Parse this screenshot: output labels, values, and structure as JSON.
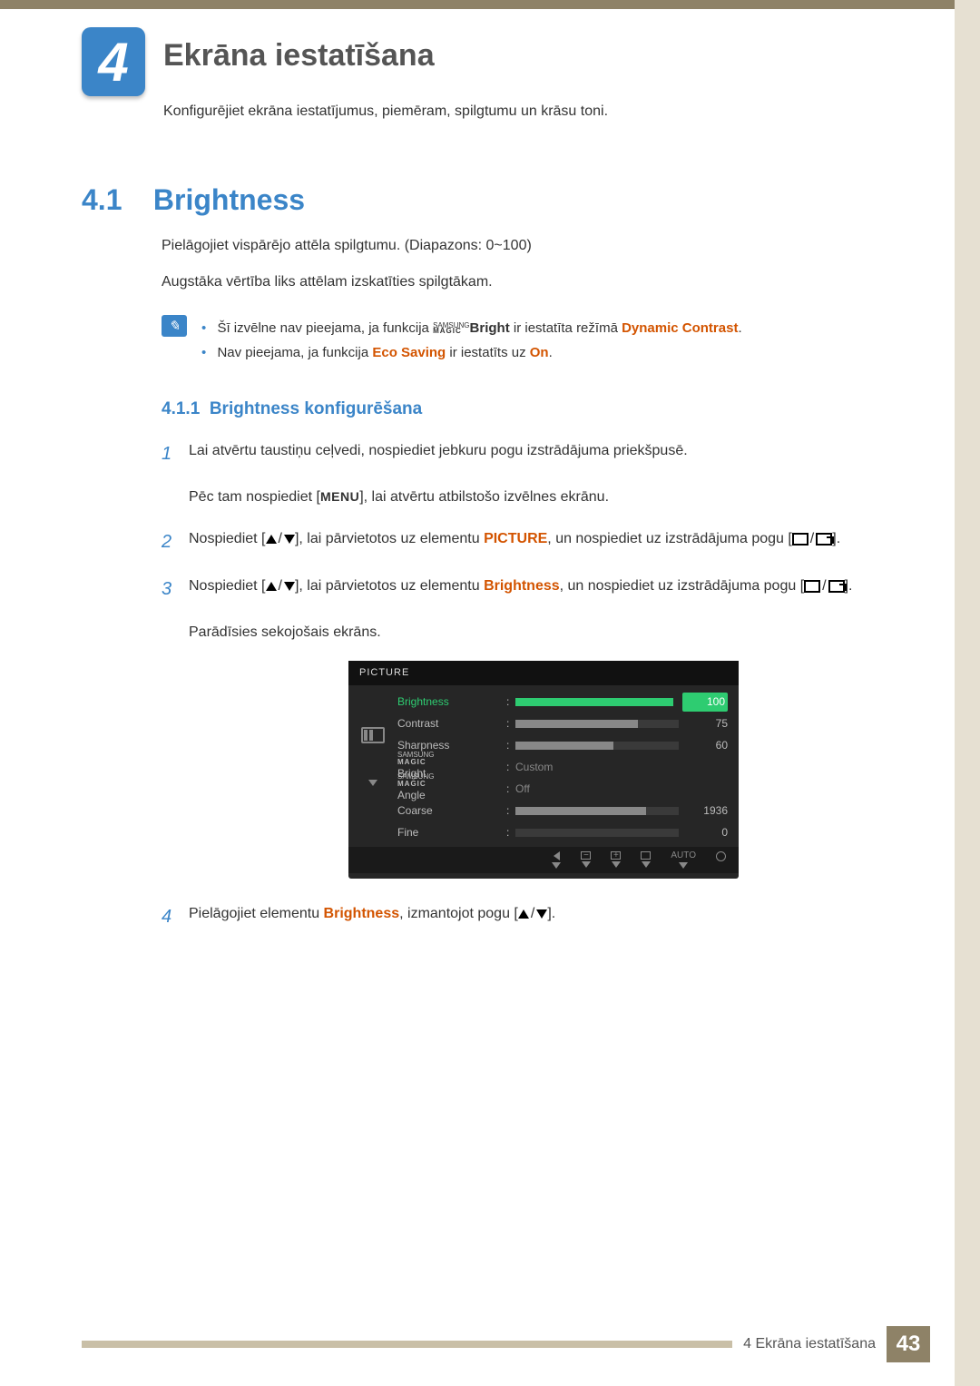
{
  "chapter": {
    "num": "4",
    "title": "Ekrāna iestatīšana",
    "sub": "Konfigurējiet ekrāna iestatījumus, piemēram, spilgtumu un krāsu toni."
  },
  "section": {
    "num": "4.1",
    "title": "Brightness"
  },
  "p1": "Pielāgojiet vispārējo attēla spilgtumu. (Diapazons: 0~100)",
  "p2": "Augstāka vērtība liks attēlam izskatīties spilgtākam.",
  "notes": {
    "n1a": "Šī izvēlne nav pieejama, ja funkcija ",
    "n1_brand_t": "SAMSUNG",
    "n1_brand_b": "MAGIC",
    "n1_brand_bold": "Bright",
    "n1b": " ir iestatīta režīmā ",
    "n1_hl": "Dynamic Contrast",
    "n1c": ".",
    "n2a": "Nav pieejama, ja funkcija ",
    "n2_hl1": "Eco Saving",
    "n2b": " ir iestatīts uz ",
    "n2_hl2": "On",
    "n2c": "."
  },
  "subsection": {
    "num": "4.1.1",
    "title": "Brightness konfigurēšana"
  },
  "steps": {
    "s1": {
      "num": "1",
      "a": "Lai atvērtu taustiņu ceļvedi, nospiediet jebkuru pogu izstrādājuma priekšpusē.",
      "b1": "Pēc tam nospiediet [",
      "menu": "MENU",
      "b2": "], lai atvērtu atbilstošo izvēlnes ekrānu."
    },
    "s2": {
      "num": "2",
      "a": "Nospiediet [",
      "b": "], lai pārvietotos uz elementu ",
      "hl": "PICTURE",
      "c": ", un nospiediet uz izstrādājuma pogu [",
      "d": "]."
    },
    "s3": {
      "num": "3",
      "a": "Nospiediet [",
      "b": "], lai pārvietotos uz elementu ",
      "hl": "Brightness",
      "c": ", un nospiediet uz izstrādājuma pogu [",
      "d": "].",
      "e": "Parādīsies sekojošais ekrāns."
    },
    "s4": {
      "num": "4",
      "a": "Pielāgojiet elementu ",
      "hl": "Brightness",
      "b": ", izmantojot pogu [",
      "c": "]."
    }
  },
  "osd": {
    "title": "PICTURE",
    "rows": [
      {
        "label": "Brightness",
        "type": "bar",
        "fill": 100,
        "val": "100",
        "active": true
      },
      {
        "label": "Contrast",
        "type": "bar",
        "fill": 75,
        "val": "75"
      },
      {
        "label": "Sharpness",
        "type": "bar",
        "fill": 60,
        "val": "60"
      },
      {
        "label_t": "SAMSUNG",
        "label_b": "MAGIC",
        "label_r": " Bright",
        "type": "text",
        "txt": "Custom"
      },
      {
        "label_t": "SAMSUNG",
        "label_b": "MAGIC",
        "label_r": " Angle",
        "type": "text",
        "txt": "Off"
      },
      {
        "label": "Coarse",
        "type": "bar",
        "fill": 80,
        "val": "1936"
      },
      {
        "label": "Fine",
        "type": "bar",
        "fill": 0,
        "val": "0"
      }
    ],
    "footer_auto": "AUTO",
    "footer_minus": "−",
    "footer_plus": "+"
  },
  "footer": {
    "text": "4 Ekrāna iestatīšana",
    "page": "43"
  }
}
